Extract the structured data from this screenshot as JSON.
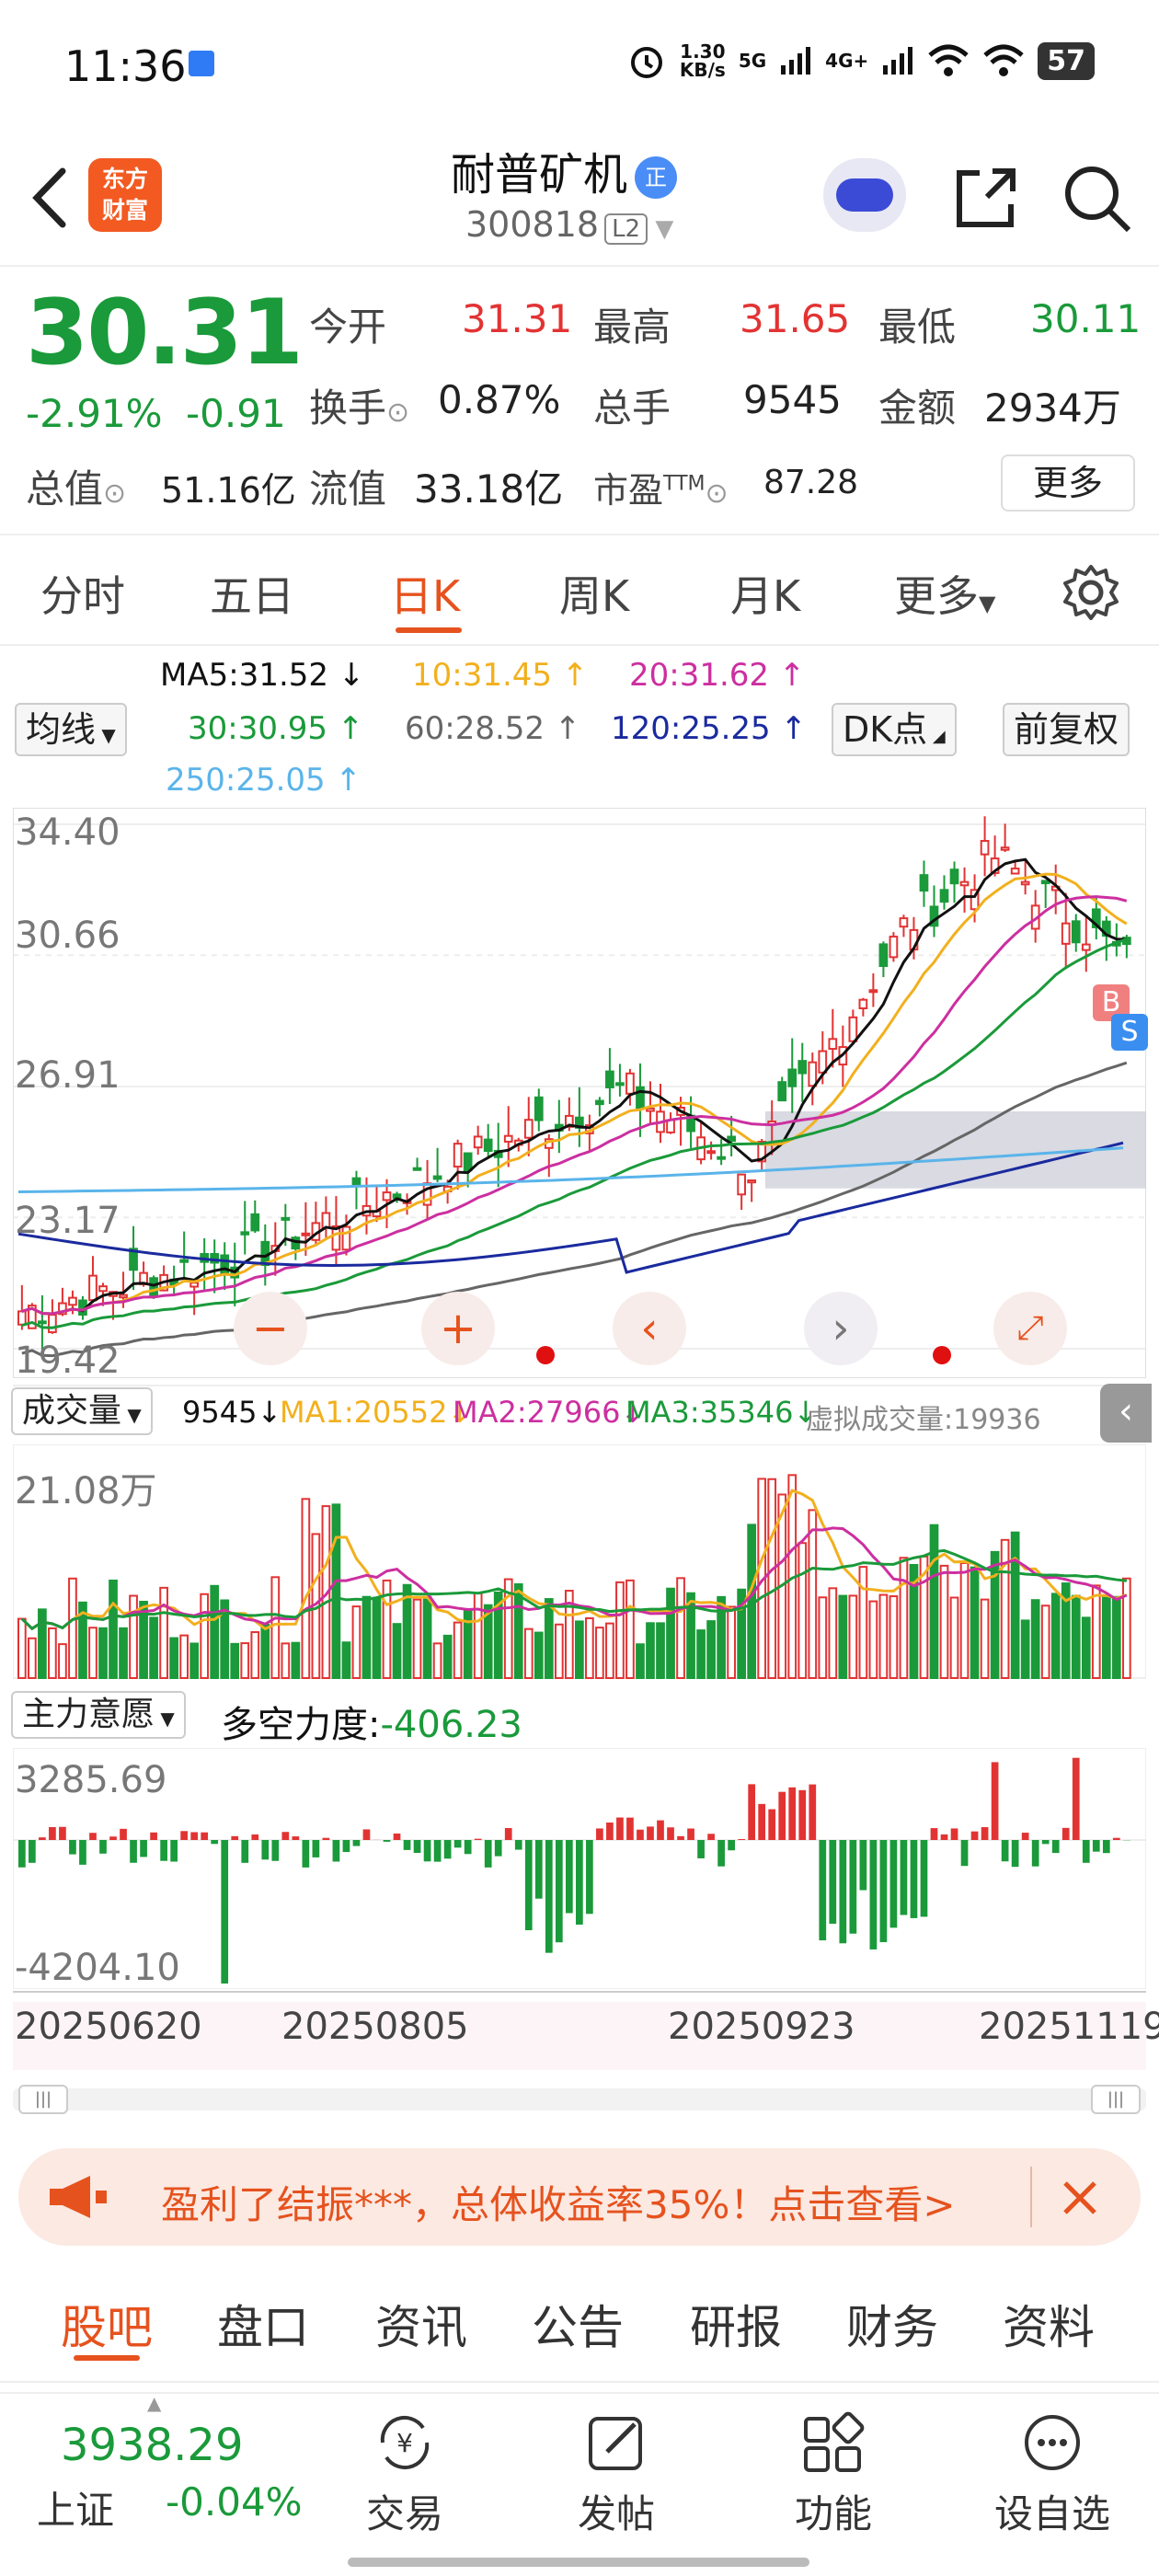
{
  "status_bar": {
    "time": "11:36",
    "net_speed_top": "1.30",
    "net_speed_bottom": "KB/s",
    "network_1": "5G",
    "network_2": "4G+",
    "battery": "57"
  },
  "header": {
    "app_logo_line1": "东方",
    "app_logo_line2": "财富",
    "stock_name": "耐普矿机",
    "badge": "正",
    "stock_code": "300818",
    "level": "L2"
  },
  "quote": {
    "price": "30.31",
    "change_pct": "-2.91%",
    "change": "-0.91",
    "open_label": "今开",
    "open": "31.31",
    "high_label": "最高",
    "high": "31.65",
    "low_label": "最低",
    "low": "30.11",
    "turnover_label": "换手",
    "turnover": "0.87%",
    "volume_label": "总手",
    "volume": "9545",
    "amount_label": "金额",
    "amount": "2934万",
    "mktcap_label": "总值",
    "mktcap": "51.16亿",
    "float_label": "流值",
    "float": "33.18亿",
    "pe_label": "市盈",
    "pe_sup": "TTM",
    "pe": "87.28",
    "more": "更多"
  },
  "period_tabs": [
    "分时",
    "五日",
    "日K",
    "周K",
    "月K",
    "更多"
  ],
  "active_period": 2,
  "indicator_bar": {
    "ma_selector": "均线",
    "ma5": "MA5:31.52 ↓",
    "ma10": "10:31.45 ↑",
    "ma20": "20:31.62 ↑",
    "ma30": "30:30.95 ↑",
    "ma60": "60:28.52 ↑",
    "ma120": "120:25.25 ↑",
    "ma250": "250:25.05 ↑",
    "dk_button": "DK点",
    "adjust_button": "前复权"
  },
  "price_axis": [
    "34.40",
    "30.66",
    "26.91",
    "23.17",
    "19.42"
  ],
  "chart_markers": {
    "buy": "B",
    "sell": "S"
  },
  "volume_panel": {
    "selector": "成交量",
    "vol": "9545↓",
    "ma1": "MA1:20552↓",
    "ma2": "MA2:27966↓",
    "ma3": "MA3:35346↓",
    "virtual": "虚拟成交量:19936",
    "axis_top": "21.08万"
  },
  "flow_panel": {
    "selector": "主力意愿",
    "label": "多空力度:",
    "value": "-406.23",
    "axis_top": "3285.69",
    "axis_bottom": "-4204.10"
  },
  "date_axis": [
    "20250620",
    "20250805",
    "20250923",
    "20251119"
  ],
  "banner": {
    "text": "盈利了结振***，总体收益率35%！点击查看>"
  },
  "bottom_tabs": [
    "股吧",
    "盘口",
    "资讯",
    "公告",
    "研报",
    "财务",
    "资料"
  ],
  "active_bottom_tab": 0,
  "bottom_nav": {
    "index_value": "3938.29",
    "index_name": "上证",
    "index_change": "-0.04%",
    "trade": "交易",
    "post": "发帖",
    "function": "功能",
    "watchlist": "设自选"
  },
  "colors": {
    "up": "#e23333",
    "down": "#1a9a3a",
    "accent": "#e6521e",
    "ma5": "#111111",
    "ma10": "#f2b01e",
    "ma20": "#cc2fa0",
    "ma30": "#1a9a3a",
    "ma60": "#666666",
    "ma120": "#1a2a9e",
    "ma250": "#5ab4ea"
  }
}
